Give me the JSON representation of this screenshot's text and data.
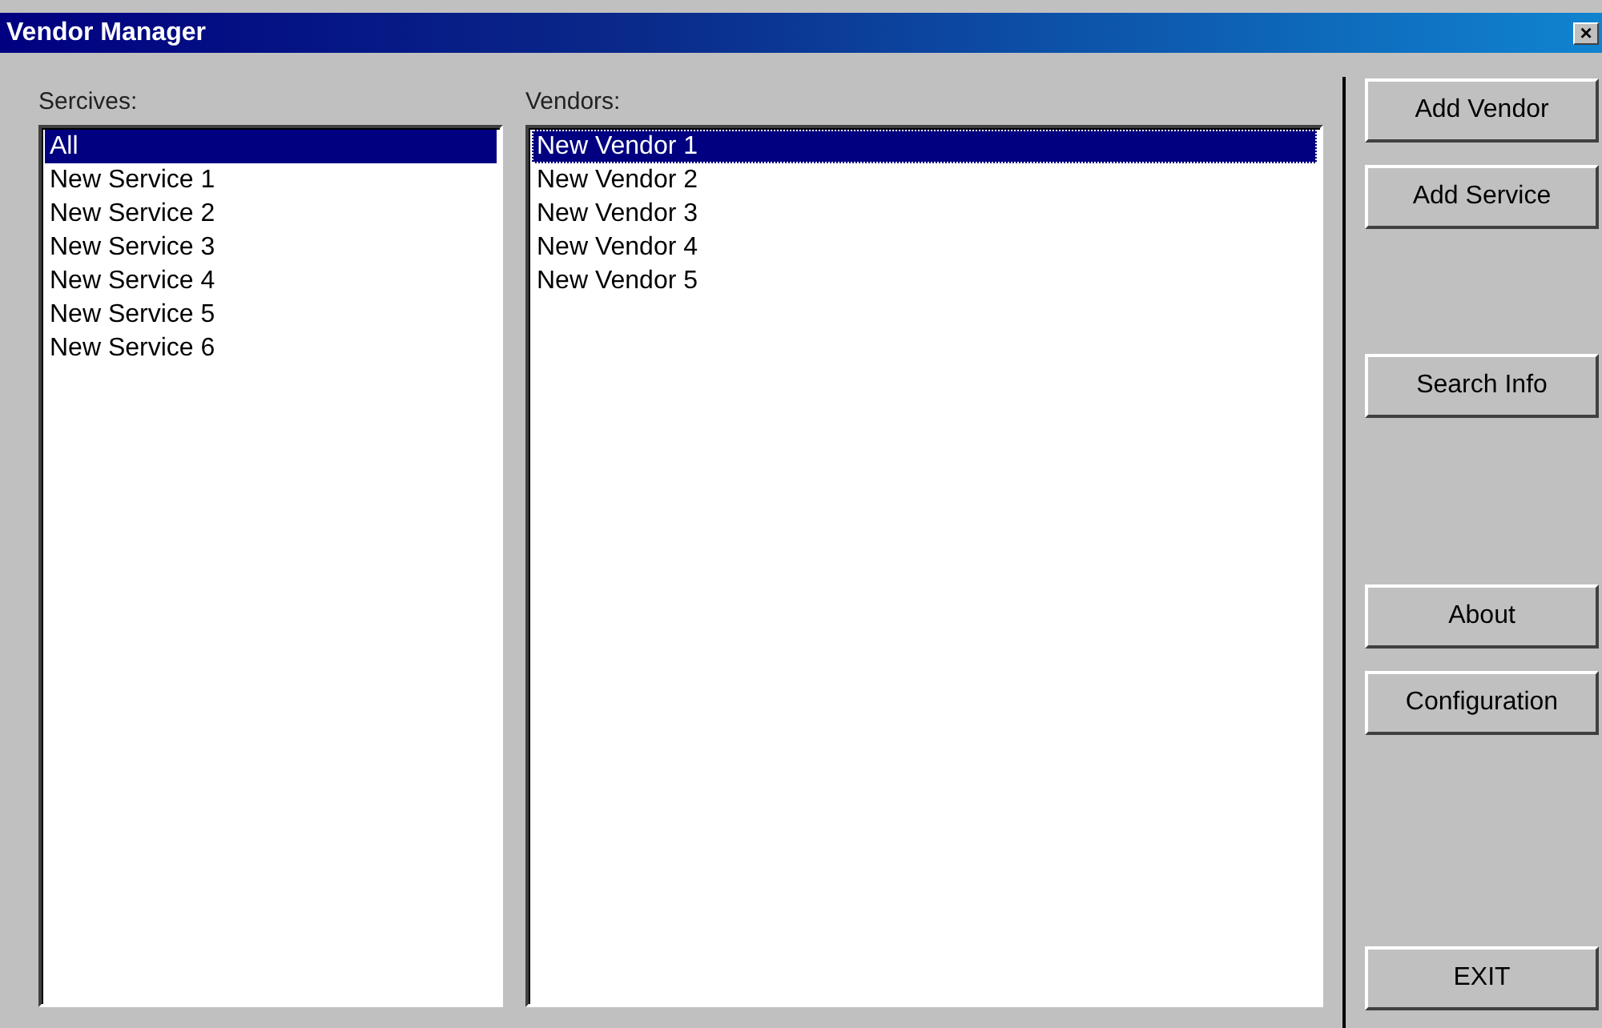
{
  "window": {
    "title": "Vendor Manager",
    "close": "×"
  },
  "services": {
    "label": "Sercives:",
    "items": [
      {
        "label": "All",
        "selected": true
      },
      {
        "label": "New Service 1",
        "selected": false
      },
      {
        "label": "New Service 2",
        "selected": false
      },
      {
        "label": "New Service 3",
        "selected": false
      },
      {
        "label": "New Service 4",
        "selected": false
      },
      {
        "label": "New Service 5",
        "selected": false
      },
      {
        "label": "New Service 6",
        "selected": false
      }
    ]
  },
  "vendors": {
    "label": "Vendors:",
    "items": [
      {
        "label": "New Vendor 1",
        "selected": true
      },
      {
        "label": "New Vendor 2",
        "selected": false
      },
      {
        "label": "New Vendor 3",
        "selected": false
      },
      {
        "label": "New Vendor 4",
        "selected": false
      },
      {
        "label": "New Vendor 5",
        "selected": false
      }
    ]
  },
  "buttons": [
    "Add Vendor",
    "Add Service",
    "Search Info",
    "About",
    "Configuration",
    "EXIT"
  ]
}
